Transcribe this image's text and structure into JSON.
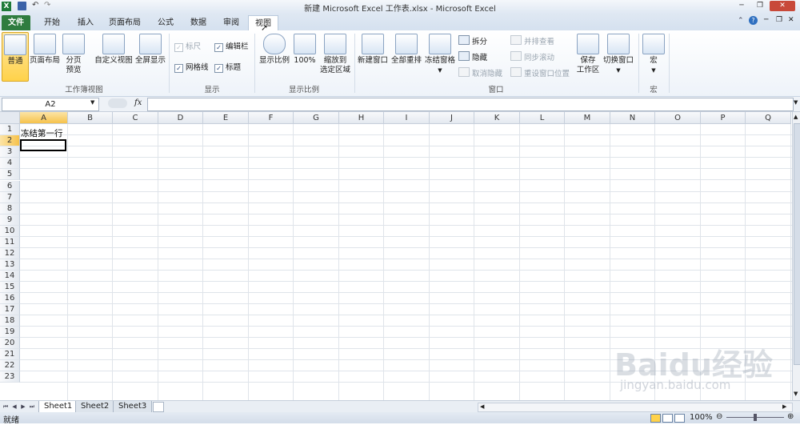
{
  "window": {
    "title": "新建 Microsoft Excel 工作表.xlsx - Microsoft Excel"
  },
  "tabs": [
    {
      "label": "文件"
    },
    {
      "label": "开始"
    },
    {
      "label": "插入"
    },
    {
      "label": "页面布局"
    },
    {
      "label": "公式"
    },
    {
      "label": "数据"
    },
    {
      "label": "审阅"
    },
    {
      "label": "视图"
    }
  ],
  "ribbon": {
    "workbook_views": {
      "label": "工作簿视图",
      "normal": "普通",
      "page_layout": "页面布局",
      "page_break_1": "分页",
      "page_break_2": "预览",
      "custom_views": "自定义视图",
      "full_screen": "全屏显示"
    },
    "show": {
      "label": "显示",
      "ruler": "标尺",
      "formula_bar": "编辑栏",
      "gridlines": "网格线",
      "headings": "标题"
    },
    "zoom": {
      "label": "显示比例",
      "zoom": "显示比例",
      "hundred": "100%",
      "zoom_sel_1": "缩放到",
      "zoom_sel_2": "选定区域"
    },
    "window": {
      "label": "窗口",
      "new_window": "新建窗口",
      "arrange_all": "全部重排",
      "freeze_panes": "冻结窗格",
      "split": "拆分",
      "hide": "隐藏",
      "unhide": "取消隐藏",
      "side_by_side": "并排查看",
      "sync_scroll": "同步滚动",
      "reset_pos": "重设窗口位置",
      "save_ws_1": "保存",
      "save_ws_2": "工作区",
      "switch_windows": "切换窗口"
    },
    "macros": {
      "label": "宏",
      "macros": "宏"
    }
  },
  "formula_bar": {
    "name_box": "A2",
    "fx": "fx",
    "value": ""
  },
  "grid": {
    "columns": [
      "A",
      "B",
      "C",
      "D",
      "E",
      "F",
      "G",
      "H",
      "I",
      "J",
      "K",
      "L",
      "M",
      "N",
      "O",
      "P",
      "Q"
    ],
    "rows": [
      "1",
      "2",
      "3",
      "4",
      "5",
      "6",
      "7",
      "8",
      "9",
      "10",
      "11",
      "12",
      "13",
      "14",
      "15",
      "16",
      "17",
      "18",
      "19",
      "20",
      "21",
      "22",
      "23"
    ],
    "cells": {
      "A1": "冻结第一行"
    },
    "active_cell": "A2"
  },
  "sheets": [
    "Sheet1",
    "Sheet2",
    "Sheet3"
  ],
  "status": {
    "ready": "就绪",
    "zoom": "100%"
  },
  "watermark": {
    "main": "Baidu经验",
    "sub": "jingyan.baidu.com"
  }
}
